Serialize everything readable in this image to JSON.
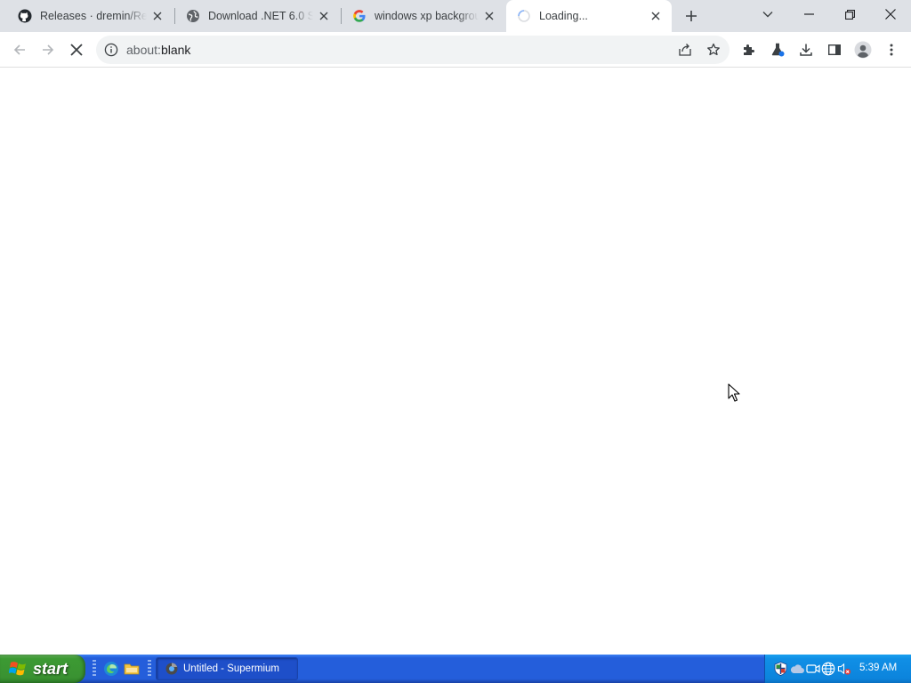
{
  "browser": {
    "tabs": [
      {
        "title": "Releases · dremin/Ret",
        "favicon": "github-icon",
        "active": false
      },
      {
        "title": "Download .NET 6.0 SD",
        "favicon": "globe-icon",
        "active": false
      },
      {
        "title": "windows xp backgrou",
        "favicon": "google-icon",
        "active": false
      },
      {
        "title": "Loading...",
        "favicon": "loading-spinner-icon",
        "active": true
      }
    ],
    "address": {
      "scheme": "about:",
      "rest": "blank"
    }
  },
  "taskbar": {
    "start_label": "start",
    "task_label": "Untitled - Supermium",
    "clock": "5:39 AM"
  },
  "colors": {
    "tabstrip_bg": "#dee1e6",
    "taskbar_blue": "#245edb",
    "start_green": "#3c9a33",
    "tray_blue": "#0c84dc"
  }
}
